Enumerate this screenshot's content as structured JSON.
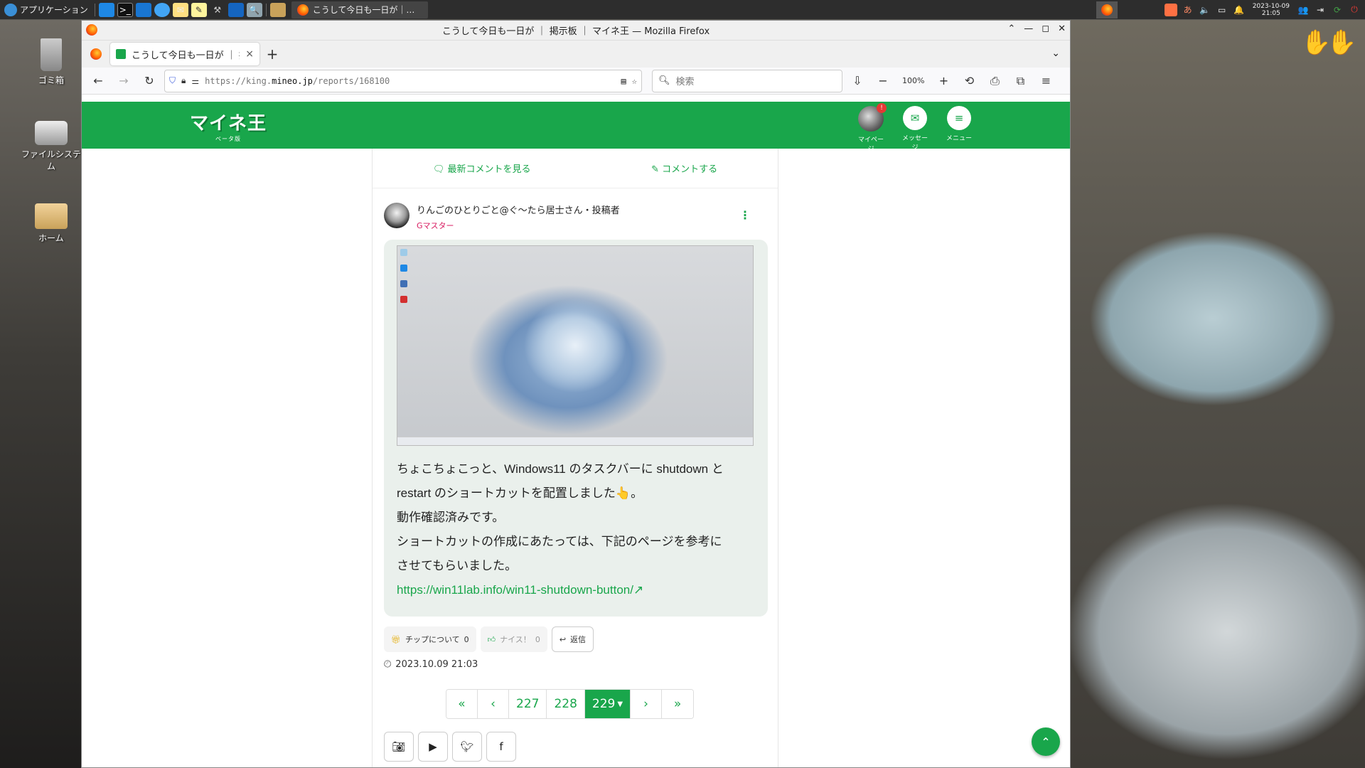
{
  "taskbar": {
    "apps_label": "アプリケーション",
    "window_title": "こうして今日も一日が｜…",
    "clock_date": "2023-10-09",
    "clock_time": "21:05"
  },
  "desktop": {
    "icons": [
      {
        "label": "ゴミ箱"
      },
      {
        "label": "ファイルシステム"
      },
      {
        "label": "ホーム"
      }
    ]
  },
  "window": {
    "title": "こうして今日も一日が ｜ 掲示板 ｜ マイネ王 — Mozilla Firefox"
  },
  "tab": {
    "title": "こうして今日も一日が ｜ 掲",
    "close": "×",
    "new_tab": "+"
  },
  "nav": {
    "url_prefix": "https://king.",
    "url_host": "mineo.jp",
    "url_path": "/reports/168100",
    "search_placeholder": "検索",
    "zoom": "100%"
  },
  "site": {
    "logo": "マイネ王",
    "logo_sub": "ベータ版",
    "mypage": "マイページ",
    "messages": "メッセージ",
    "menu": "メニュー",
    "badge": "!"
  },
  "content": {
    "latest_comments": "最新コメントを見る",
    "post_comment": "コメントする",
    "username": "りんごのひとりごと@ぐ〜たら居士さん・投稿者",
    "rank": "Gマスター",
    "body_lines": [
      "ちょこちょこっと、Windows11 のタスクバーに shutdown と",
      "restart のショートカットを配置しました👆。",
      "動作確認済みです。",
      "ショートカットの作成にあたっては、下記のページを参考に",
      "させてもらいました。"
    ],
    "link": "https://win11lab.info/win11-shutdown-button/",
    "tip_label": "チップについて",
    "tip_count": "0",
    "nice_label": "ナイス！",
    "nice_count": "0",
    "reply_label": "返信",
    "timestamp": "2023.10.09 21:03"
  },
  "pager": {
    "first": "«",
    "prev": "‹",
    "pages": [
      "227",
      "228"
    ],
    "current": "229",
    "next": "›",
    "last": "»"
  }
}
